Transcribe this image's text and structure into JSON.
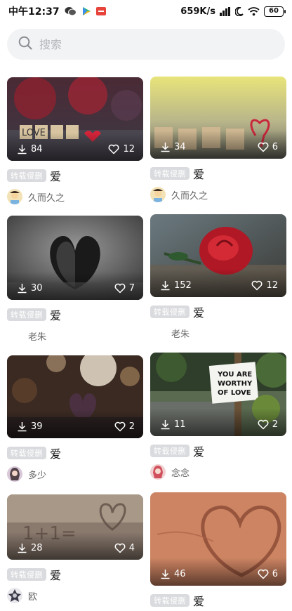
{
  "status": {
    "time": "中午12:37",
    "speed": "659K/s",
    "battery": "60"
  },
  "search": {
    "placeholder": "搜索"
  },
  "cards": [
    {
      "downloads": "84",
      "likes": "12",
      "tag": "转载侵删",
      "title": "爱",
      "author": "久而久之",
      "avatar": "cartoon-avatar"
    },
    {
      "downloads": "34",
      "likes": "6",
      "tag": "转载侵删",
      "title": "爱",
      "author": "久而久之",
      "avatar": "cartoon-avatar"
    },
    {
      "downloads": "30",
      "likes": "7",
      "tag": "转载侵删",
      "title": "爱",
      "author": "老朱",
      "avatar": ""
    },
    {
      "downloads": "152",
      "likes": "12",
      "tag": "转载侵删",
      "title": "爱",
      "author": "老朱",
      "avatar": ""
    },
    {
      "downloads": "39",
      "likes": "2",
      "tag": "转载侵删",
      "title": "爱",
      "author": "多少",
      "avatar": "girl-avatar"
    },
    {
      "downloads": "11",
      "likes": "2",
      "tag": "转载侵删",
      "title": "爱",
      "author": "念念",
      "avatar": "girl-avatar"
    },
    {
      "downloads": "28",
      "likes": "4",
      "tag": "转载侵删",
      "title": "爱",
      "author": "欧",
      "avatar": "badge-avatar"
    },
    {
      "downloads": "46",
      "likes": "6",
      "tag": "转载侵删",
      "title": "爱",
      "author": "",
      "avatar": ""
    }
  ],
  "images": {
    "sign_text": [
      "YOU ARE",
      "WORTHY",
      "OF LOVE"
    ],
    "tiles_text": "LOVE",
    "sand_text": "1+1="
  },
  "colors": {
    "tag_bg": "#dadbde",
    "search_bg": "#f2f3f5"
  }
}
